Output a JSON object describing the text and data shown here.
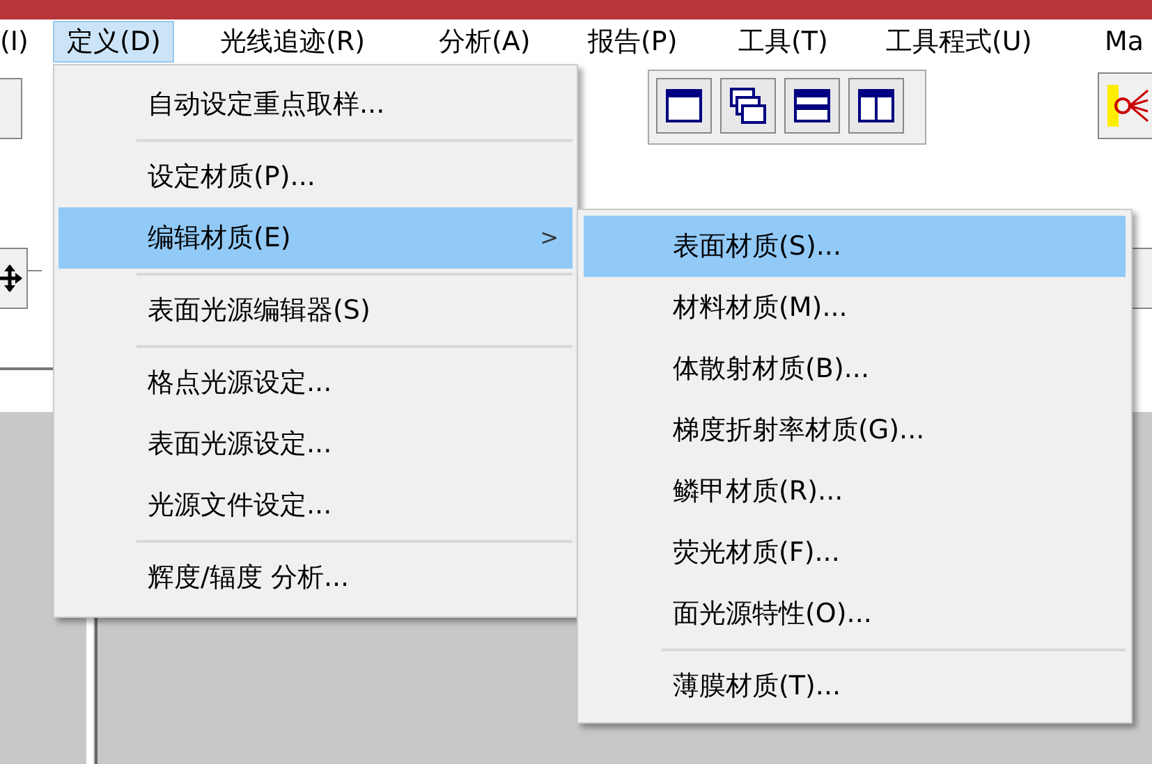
{
  "menu_bar": [
    {
      "label": "(I)",
      "selected": false
    },
    {
      "label": "定义(D)",
      "selected": true
    },
    {
      "label": "光线追迹(R)",
      "selected": false
    },
    {
      "label": "分析(A)",
      "selected": false
    },
    {
      "label": "报告(P)",
      "selected": false
    },
    {
      "label": "工具(T)",
      "selected": false
    },
    {
      "label": "工具程式(U)",
      "selected": false
    },
    {
      "label": "Ma",
      "selected": false
    }
  ],
  "menu": {
    "items": [
      {
        "kind": "item",
        "label": "自动设定重点取样...",
        "selected": false
      },
      {
        "kind": "separator"
      },
      {
        "kind": "item",
        "label": "设定材质(P)...",
        "selected": false
      },
      {
        "kind": "submenu",
        "label": "编辑材质(E)",
        "arrow": ">",
        "selected": true
      },
      {
        "kind": "separator"
      },
      {
        "kind": "item",
        "label": "表面光源编辑器(S)",
        "selected": false
      },
      {
        "kind": "separator"
      },
      {
        "kind": "item",
        "label": "格点光源设定...",
        "selected": false
      },
      {
        "kind": "item",
        "label": "表面光源设定...",
        "selected": false
      },
      {
        "kind": "item",
        "label": "光源文件设定...",
        "selected": false
      },
      {
        "kind": "separator"
      },
      {
        "kind": "item",
        "label": "辉度/辐度 分析...",
        "selected": false
      }
    ]
  },
  "submenu": {
    "items": [
      {
        "kind": "item",
        "label": "表面材质(S)...",
        "selected": true
      },
      {
        "kind": "item",
        "label": "材料材质(M)...",
        "selected": false
      },
      {
        "kind": "item",
        "label": "体散射材质(B)...",
        "selected": false
      },
      {
        "kind": "item",
        "label": "梯度折射率材质(G)...",
        "selected": false
      },
      {
        "kind": "item",
        "label": "鳞甲材质(R)...",
        "selected": false
      },
      {
        "kind": "item",
        "label": "荧光材质(F)...",
        "selected": false
      },
      {
        "kind": "item",
        "label": "面光源特性(O)...",
        "selected": false
      },
      {
        "kind": "separator"
      },
      {
        "kind": "item",
        "label": "薄膜材质(T)...",
        "selected": false
      }
    ]
  }
}
